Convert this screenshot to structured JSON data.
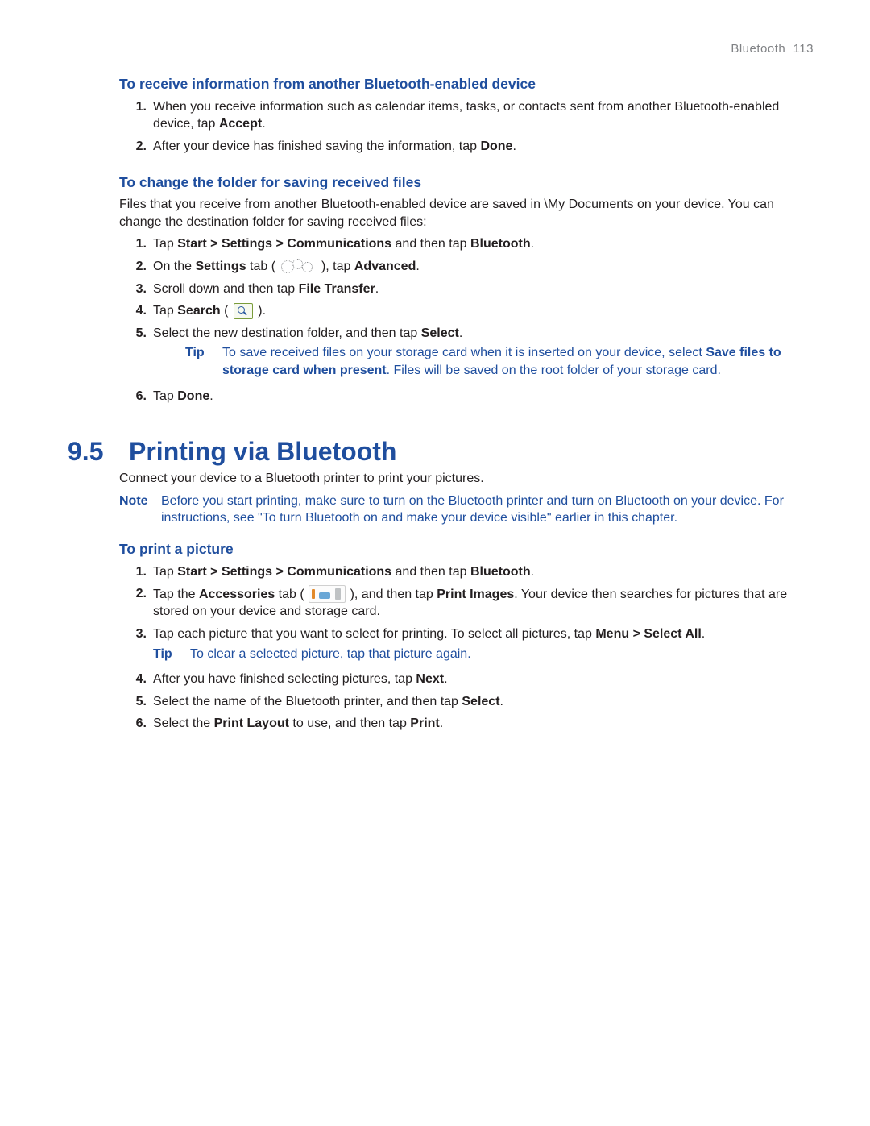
{
  "header": {
    "chapter": "Bluetooth",
    "page": "113"
  },
  "sec1": {
    "title": "To receive information from another Bluetooth-enabled device",
    "steps": [
      {
        "n": "1.",
        "pre": "When you receive information such as calendar items, tasks, or contacts sent from another Bluetooth-enabled device, tap ",
        "b1": "Accept",
        "post": "."
      },
      {
        "n": "2.",
        "pre": "After your device has finished saving the information, tap ",
        "b1": "Done",
        "post": "."
      }
    ]
  },
  "sec2": {
    "title": "To change the folder for saving received files",
    "intro": "Files that you receive from another Bluetooth-enabled device are saved in \\My Documents on your device. You can change the destination folder for saving received files:",
    "step1": {
      "n": "1.",
      "a": "Tap ",
      "b1": "Start > Settings > Communications",
      "c": " and then tap ",
      "b2": "Bluetooth",
      "d": "."
    },
    "step2": {
      "n": "2.",
      "a": "On the ",
      "b1": "Settings",
      "c": " tab (  ",
      "d": "  ), tap ",
      "b2": "Advanced",
      "e": "."
    },
    "step3": {
      "n": "3.",
      "a": "Scroll down and then tap ",
      "b1": "File Transfer",
      "c": "."
    },
    "step4": {
      "n": "4.",
      "a": "Tap ",
      "b1": "Search",
      "c": " (  ",
      "d": "  )."
    },
    "step5": {
      "n": "5.",
      "a": "Select the new destination folder, and then tap ",
      "b1": "Select",
      "c": ".",
      "tip_label": "Tip",
      "tip_a": "To save received files on your storage card when it is inserted on your device, select ",
      "tip_b": "Save files to storage card when present",
      "tip_c": ". Files will be saved on the root folder of your storage card."
    },
    "step6": {
      "n": "6.",
      "a": "Tap ",
      "b1": "Done",
      "c": "."
    }
  },
  "sec3": {
    "number": "9.5",
    "title": "Printing via Bluetooth",
    "intro": "Connect your device to a Bluetooth printer to print your pictures.",
    "note_label": "Note",
    "note_body": "Before you start printing, make sure to turn on the Bluetooth printer and turn on Bluetooth on your device. For instructions, see \"To turn Bluetooth on and make your device visible\" earlier in this chapter."
  },
  "sec4": {
    "title": "To print a picture",
    "step1": {
      "n": "1.",
      "a": "Tap ",
      "b1": "Start > Settings > Communications",
      "c": " and then tap ",
      "b2": "Bluetooth",
      "d": "."
    },
    "step2": {
      "n": "2.",
      "a": "Tap the ",
      "b1": "Accessories",
      "c": " tab (  ",
      "d": "  ), and then tap ",
      "b2": "Print Images",
      "e": ". Your device then searches for pictures that are stored on your device and storage card."
    },
    "step3": {
      "n": "3.",
      "a": "Tap each picture that you want to select for printing. To select all pictures, tap ",
      "b1": "Menu > Select All",
      "c": ".",
      "tip_label": "Tip",
      "tip_body": "To clear a selected picture, tap that picture again."
    },
    "step4": {
      "n": "4.",
      "a": "After you have finished selecting pictures, tap ",
      "b1": "Next",
      "c": "."
    },
    "step5": {
      "n": "5.",
      "a": "Select the name of the Bluetooth printer, and then tap ",
      "b1": "Select",
      "c": "."
    },
    "step6": {
      "n": "6.",
      "a": "Select the ",
      "b1": "Print Layout",
      "c": " to use, and then tap ",
      "b2": "Print",
      "d": "."
    }
  }
}
